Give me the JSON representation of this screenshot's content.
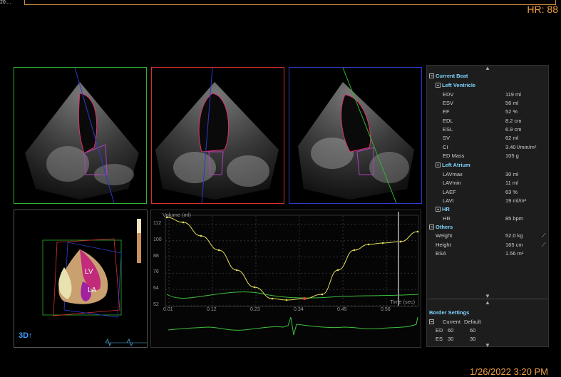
{
  "top": {
    "tab_label": "20:...",
    "hr": "HR: 88"
  },
  "views": {
    "mode_label": "3D↑"
  },
  "heart_labels": {
    "lv": "LV",
    "la": "LA"
  },
  "graph": {
    "ylabel": "Volume (ml)",
    "xlabel": "Time (sec)",
    "yticks": [
      "112",
      "100",
      "88",
      "76",
      "64",
      "52"
    ],
    "xticks": [
      "0.01",
      "0.12",
      "0.23",
      "0.34",
      "0.45",
      "0.56"
    ]
  },
  "panel": {
    "current_beat": "Current Beat",
    "left_ventricle": "Left Ventricle",
    "lv_rows": [
      {
        "label": "EDV",
        "value": "119 ml"
      },
      {
        "label": "ESV",
        "value": "56 ml"
      },
      {
        "label": "EF",
        "value": "52 %"
      },
      {
        "label": "EDL",
        "value": "8.2 cm"
      },
      {
        "label": "ESL",
        "value": "6.9 cm"
      },
      {
        "label": "SV",
        "value": "62 ml"
      },
      {
        "label": "CI",
        "value": "3.40 l/min/m²"
      },
      {
        "label": "ED Mass",
        "value": "105 g"
      }
    ],
    "left_atrium": "Left Atrium",
    "la_rows": [
      {
        "label": "LAVmax",
        "value": "30 ml"
      },
      {
        "label": "LAVmin",
        "value": "11 ml"
      },
      {
        "label": "LAEF",
        "value": "63 %"
      },
      {
        "label": "LAVI",
        "value": "19 ml/m²"
      }
    ],
    "hr_section": "HR",
    "hr_row": {
      "label": "HR",
      "value": "85 bpm"
    },
    "others": "Others",
    "other_rows": [
      {
        "label": "Weight",
        "value": "52.0 kg"
      },
      {
        "label": "Height",
        "value": "165 cm"
      },
      {
        "label": "BSA",
        "value": "1.56 m²"
      }
    ],
    "border_settings": "Border Settings",
    "border_cols": {
      "current": "Current",
      "default": "Default"
    },
    "border_rows": [
      {
        "label": "ED",
        "current": "60",
        "default": "60"
      },
      {
        "label": "ES",
        "current": "30",
        "default": "30"
      }
    ]
  },
  "footer": {
    "datetime": "1/26/2022 3:20 PM"
  },
  "colors": {
    "accent": "#f0a040",
    "section_header": "#7fd4ff",
    "view1": "#2fb52f",
    "view2": "#d83030",
    "view3": "#2e3acb",
    "volume_curve": "#e6e05a",
    "ecg": "#3fbf3f"
  }
}
